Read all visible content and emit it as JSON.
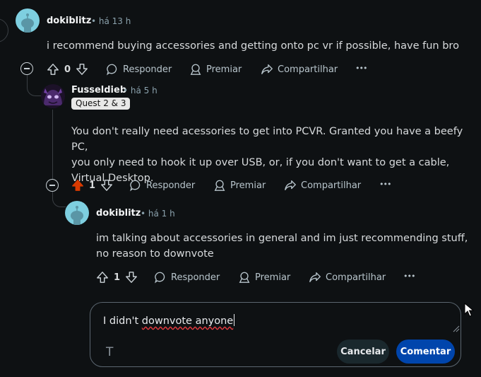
{
  "colors": {
    "background": "#0e1113",
    "upvote_active": "#d93a00",
    "primary_button": "#0045ac",
    "secondary_button": "#1a282d"
  },
  "comment1": {
    "username": "dokiblitz",
    "time": "• há 13 h",
    "text": "i recommend buying accessories and getting onto pc vr if possible, have fun bro",
    "votes": "0"
  },
  "comment2": {
    "username": "Fusseldieb",
    "time": "• há 5 h",
    "flair": "Quest 2 & 3",
    "text_lines": [
      "You don't really need acessories to get into PCVR. Granted you have a beefy PC,",
      "you only need to hook it up over USB, or, if you don't want to get a cable,",
      "Virtual Desktop."
    ],
    "votes": "1"
  },
  "comment3": {
    "username": "dokiblitz",
    "time": "• há 1 h",
    "text_lines": [
      "im talking about accessories in general and im just recommending stuff,",
      "no reason to downvote"
    ],
    "votes": "1"
  },
  "actions": {
    "reply": "Responder",
    "award": "Premiar",
    "share": "Compartilhar",
    "more": "•••"
  },
  "reply_box": {
    "text_plain": "I didn't ",
    "text_underlined": "downvote anyone",
    "format_icon": "T",
    "cancel": "Cancelar",
    "submit": "Comentar"
  }
}
